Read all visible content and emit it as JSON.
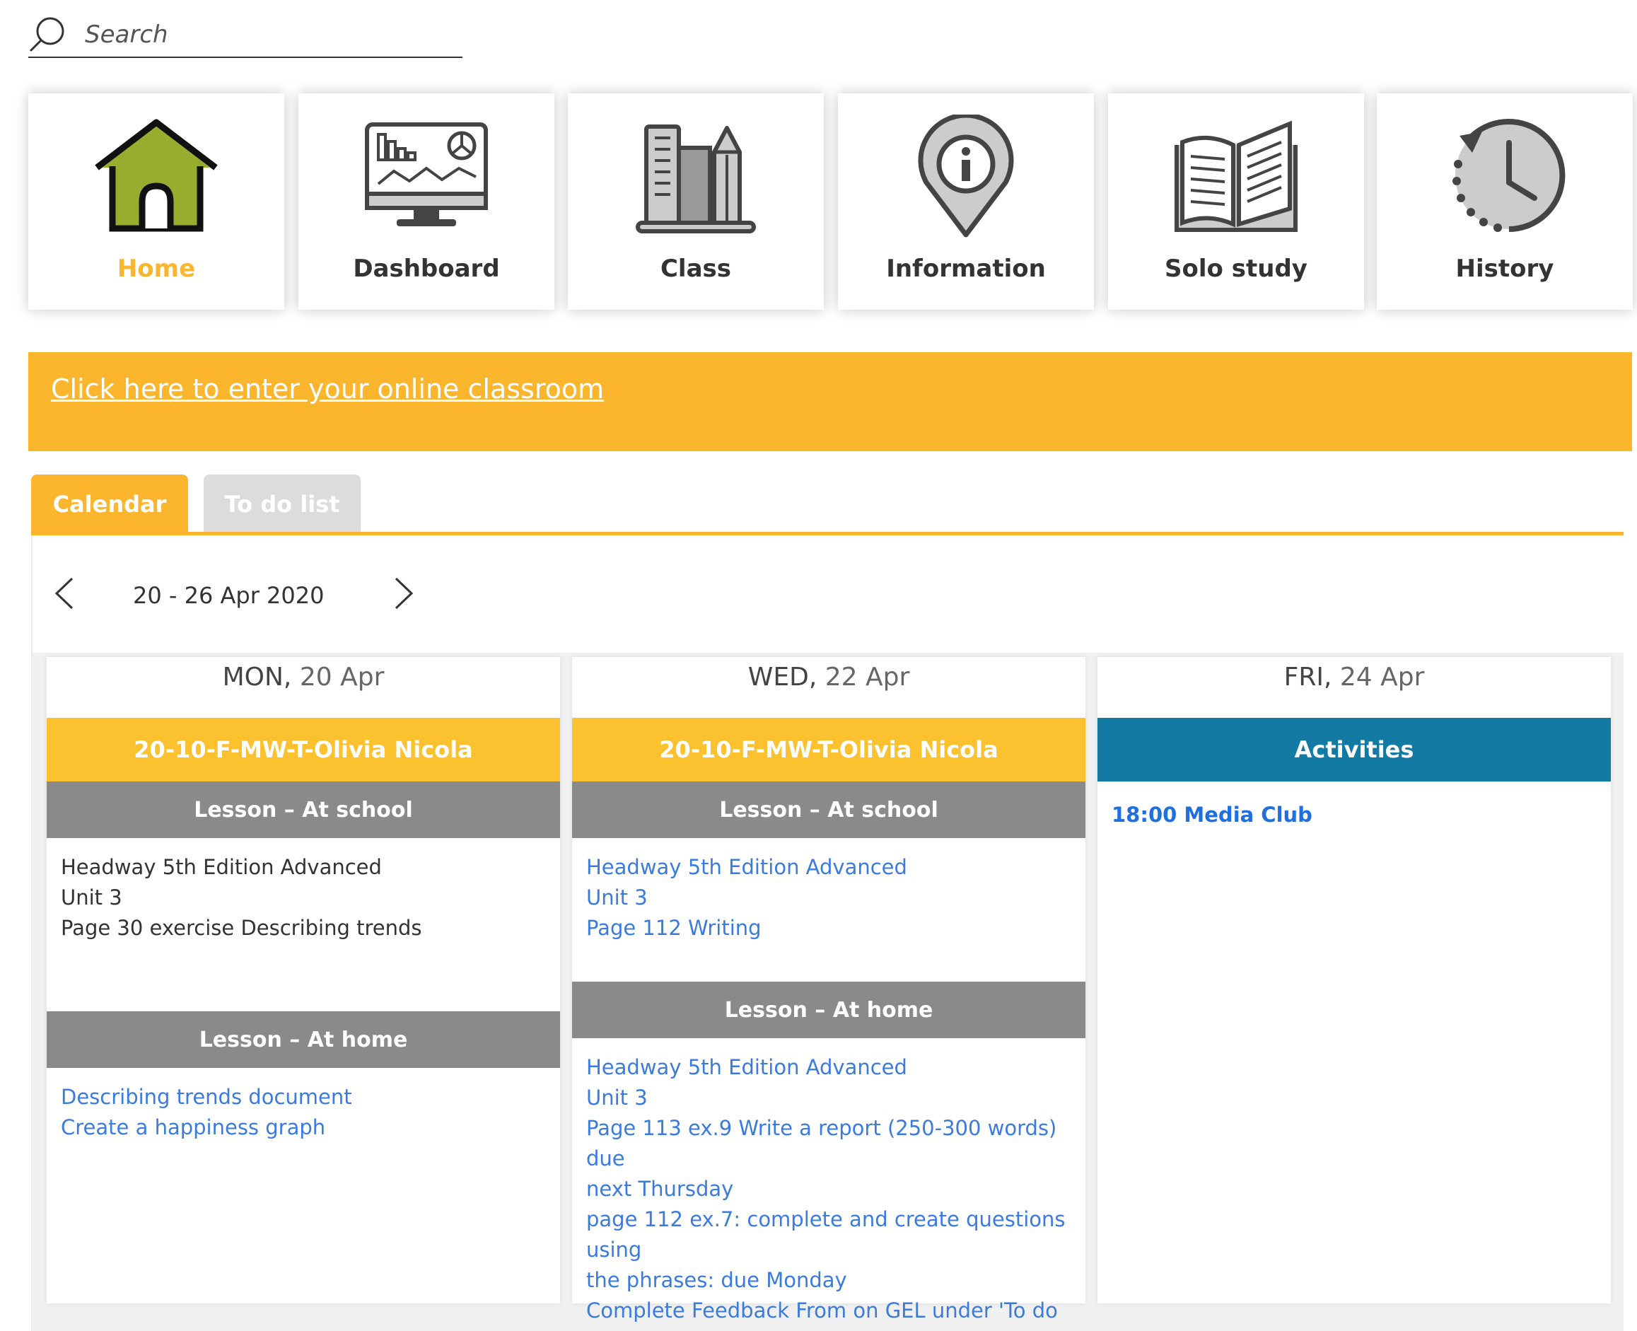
{
  "search": {
    "placeholder": "Search",
    "icon": "search-icon"
  },
  "nav": [
    {
      "label": "Home",
      "icon": "home-icon",
      "active": true
    },
    {
      "label": "Dashboard",
      "icon": "dashboard-monitor-icon"
    },
    {
      "label": "Class",
      "icon": "books-pencil-icon"
    },
    {
      "label": "Information",
      "icon": "info-pin-icon"
    },
    {
      "label": "Solo study",
      "icon": "open-book-icon"
    },
    {
      "label": "History",
      "icon": "history-clock-icon"
    }
  ],
  "banner": {
    "link_text": "Click here to enter your online classroom",
    "color": "#fbb62e"
  },
  "tabs": {
    "calendar": "Calendar",
    "todo": "To do list"
  },
  "week": {
    "label": "20 - 26 Apr 2020"
  },
  "days": [
    {
      "day": "MON,",
      "date": "20 Apr",
      "class_name": "20-10-F-MW-T-Olivia Nicola",
      "school_title": "Lesson – At school",
      "school_lines": [
        "Headway 5th Edition Advanced",
        "Unit 3",
        "Page 30 exercise Describing trends"
      ],
      "home_title": "Lesson – At home",
      "home_lines": [
        "Describing trends document",
        "Create a happiness graph"
      ]
    },
    {
      "day": "WED,",
      "date": "22 Apr",
      "class_name": "20-10-F-MW-T-Olivia Nicola",
      "school_title": "Lesson – At school",
      "school_lines": [
        "Headway 5th Edition Advanced",
        "Unit 3",
        "Page 112 Writing"
      ],
      "home_title": "Lesson – At home",
      "home_lines": [
        "Headway 5th Edition Advanced",
        "Unit 3",
        "Page 113 ex.9 Write a report (250-300 words) due",
        "next Thursday",
        "page 112 ex.7: complete and create questions using",
        "the phrases: due Monday",
        "Complete Feedback From on GEL under 'To do List'"
      ]
    },
    {
      "day": "FRI,",
      "date": "24 Apr",
      "activities_title": "Activities",
      "activity": "18:00 Media Club"
    }
  ],
  "colors": {
    "accent": "#fbb62e",
    "class_bar": "#fbc12e",
    "activities": "#137ba3",
    "section": "#8a8a8a",
    "link": "#3a7be0"
  }
}
